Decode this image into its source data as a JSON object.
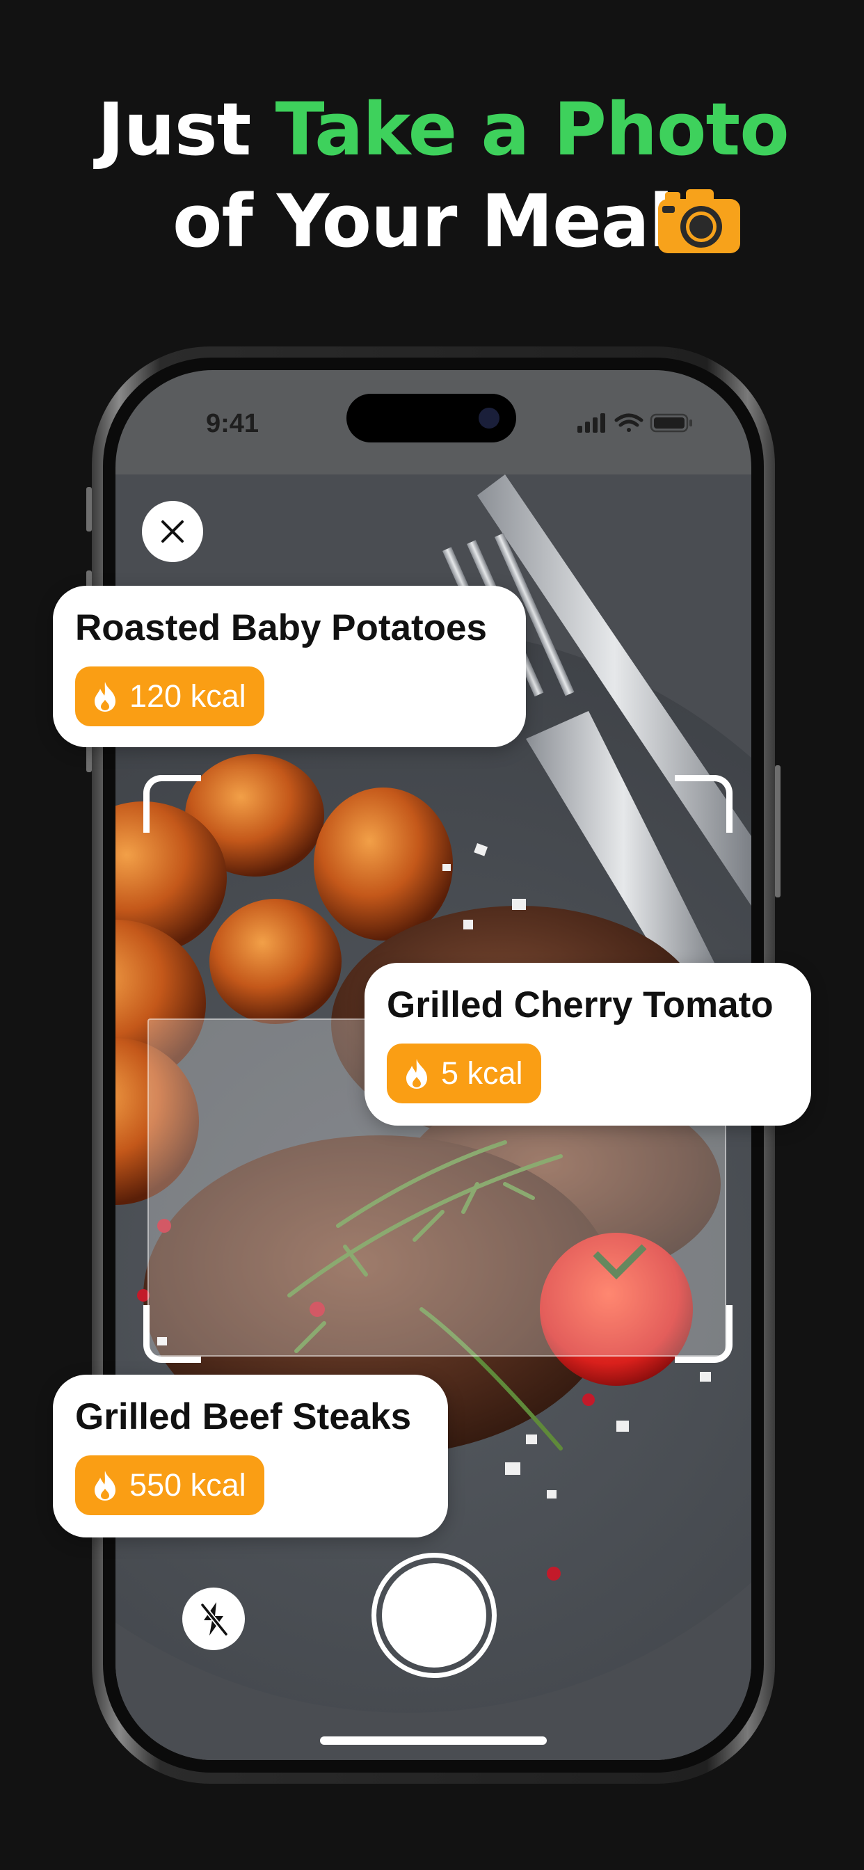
{
  "headline": {
    "line1_prefix": "Just ",
    "line1_accent": "Take a Photo",
    "line2": "of Your Meal",
    "accent_color": "#3ed15c",
    "emoji": "camera-icon"
  },
  "status_bar": {
    "time": "9:41",
    "icons": [
      "signal-icon",
      "wifi-icon",
      "battery-icon"
    ]
  },
  "camera": {
    "close_icon": "close-icon",
    "flash_icon": "flash-off-icon",
    "shutter_icon": "shutter-button"
  },
  "detections": [
    {
      "name": "Roasted Baby Potatoes",
      "calories": "120 kcal"
    },
    {
      "name": "Grilled Cherry Tomato",
      "calories": "5 kcal"
    },
    {
      "name": "Grilled Beef Steaks",
      "calories": "550 kcal"
    }
  ],
  "colors": {
    "background": "#121212",
    "accent_green": "#3ed15c",
    "kcal_orange": "#fa9e14",
    "card": "#ffffff"
  }
}
